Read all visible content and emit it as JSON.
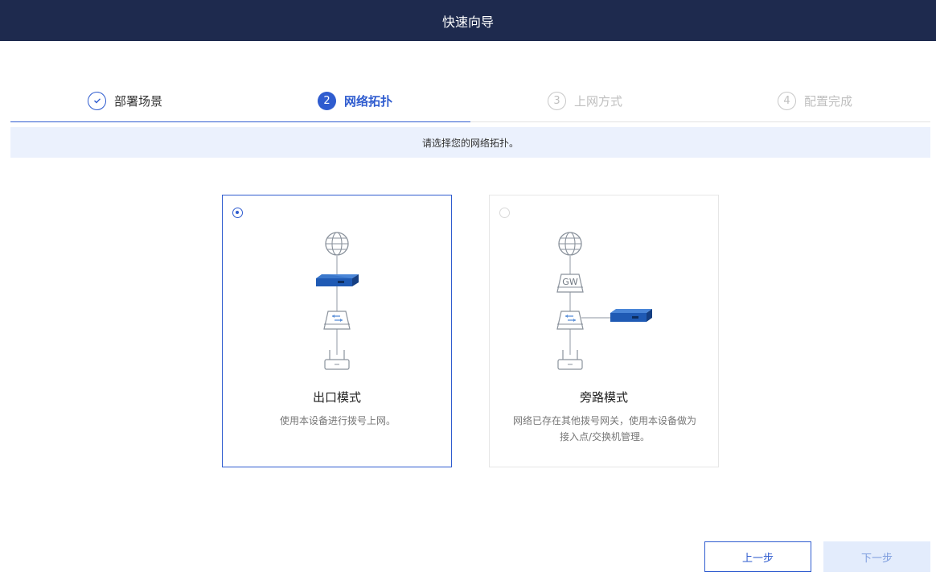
{
  "header": {
    "title": "快速向导"
  },
  "steps": [
    {
      "label": "部署场景",
      "status": "done",
      "icon": "check-icon"
    },
    {
      "label": "网络拓扑",
      "status": "active",
      "num": "2"
    },
    {
      "label": "上网方式",
      "status": "pending",
      "num": "3"
    },
    {
      "label": "配置完成",
      "status": "pending",
      "num": "4"
    }
  ],
  "banner": {
    "text": "请选择您的网络拓扑。"
  },
  "cards": [
    {
      "title": "出口模式",
      "desc": "使用本设备进行拨号上网。",
      "selected": true
    },
    {
      "title": "旁路模式",
      "desc": "网络已存在其他拨号网关，使用本设备做为接入点/交换机管理。",
      "selected": false,
      "gateway_label": "GW"
    }
  ],
  "buttons": {
    "prev": "上一步",
    "next": "下一步"
  },
  "colors": {
    "header_bg": "#1e2a4e",
    "accent": "#2f5ccf",
    "banner_bg": "#ebf1fd",
    "device_blue": "#1f5ab4"
  }
}
